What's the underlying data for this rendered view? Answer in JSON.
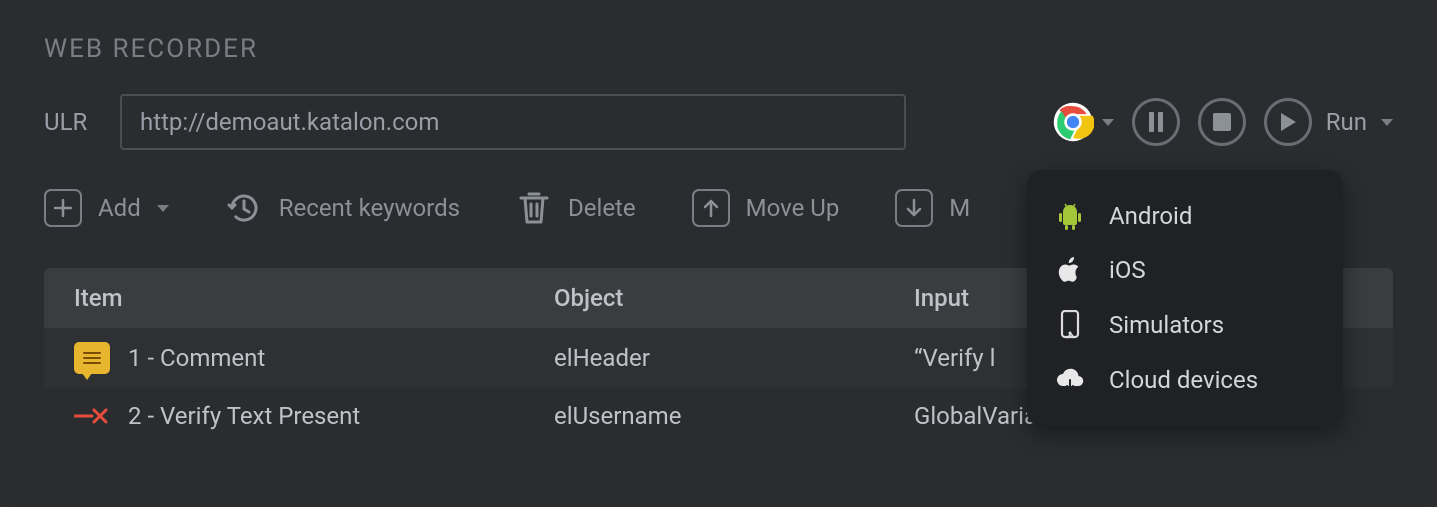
{
  "title": "WEB RECORDER",
  "url": {
    "label": "ULR",
    "value": "http://demoaut.katalon.com"
  },
  "controls": {
    "run_label": "Run"
  },
  "toolbar": {
    "add": "Add",
    "recent": "Recent keywords",
    "delete": "Delete",
    "move_up": "Move Up",
    "move_down": "M"
  },
  "table": {
    "headers": {
      "item": "Item",
      "object": "Object",
      "input": "Input"
    },
    "rows": [
      {
        "item": "1 - Comment",
        "object": "elHeader",
        "input": "“Verify l"
      },
      {
        "item": "2 - Verify Text Present",
        "object": "elUsername",
        "input": "GlobalVariable.element_timeout"
      }
    ]
  },
  "dropdown": {
    "items": [
      {
        "label": "Android"
      },
      {
        "label": "iOS"
      },
      {
        "label": "Simulators"
      },
      {
        "label": "Cloud devices"
      }
    ]
  }
}
